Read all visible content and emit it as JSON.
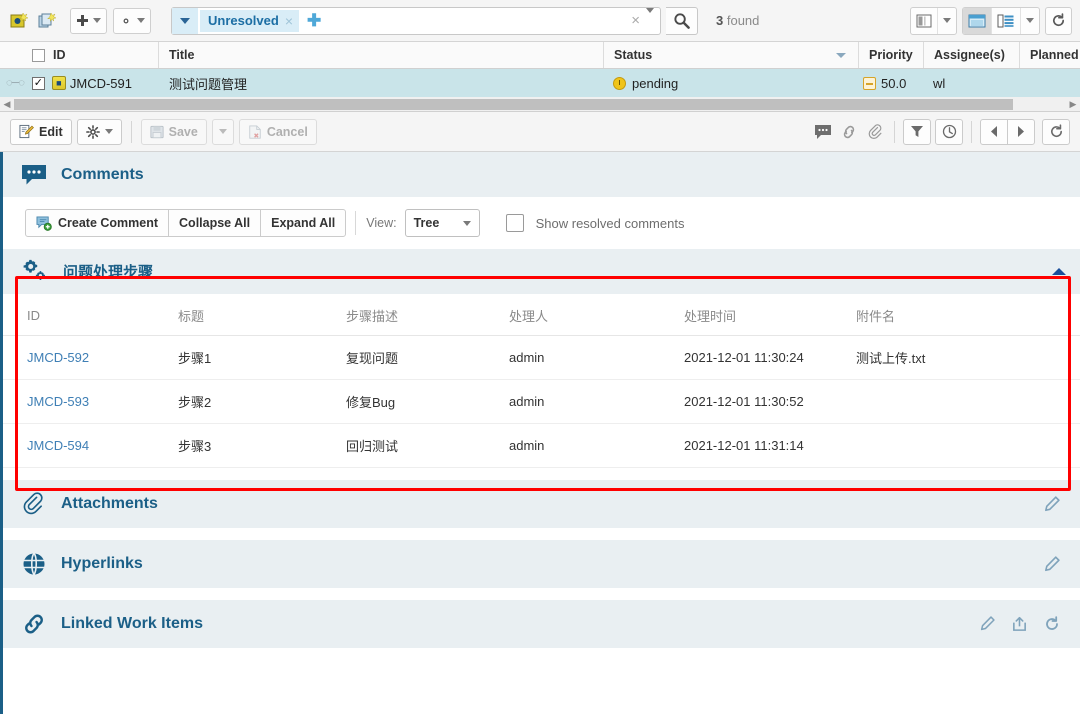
{
  "toolbar": {
    "icons": [
      {
        "name": "new-work-item-icon",
        "glyph": "⬛"
      },
      {
        "name": "new-document-icon",
        "glyph": "⬛"
      }
    ],
    "add_button_label": "",
    "settings_button_label": "",
    "search": {
      "token": "Unresolved",
      "token_remove": "×",
      "add_token": "➕",
      "clear": "×",
      "placeholder": "",
      "results_count": "3",
      "results_label": "found"
    },
    "view_buttons": {
      "columns_label": "",
      "table_view_label": "",
      "detail_view_label": "",
      "refresh_label": "↻"
    }
  },
  "grid": {
    "columns": [
      "ID",
      "Title",
      "Status",
      "Priority",
      "Assignee(s)",
      "Planned"
    ],
    "rows": [
      {
        "id": "JMCD-591",
        "title": "测试问题管理",
        "status": "pending",
        "priority": "50.0",
        "assignee": "wl",
        "planned": "",
        "checked": "✓"
      }
    ]
  },
  "actionbar": {
    "edit_label": "Edit",
    "gear_label": "",
    "save_label": "Save",
    "cancel_label": "Cancel",
    "icons": [
      "comment-icon",
      "link-icon",
      "attachment-icon"
    ],
    "buttons": [
      "filter-icon",
      "history-icon",
      "prev-icon",
      "next-icon",
      "refresh-icon"
    ]
  },
  "comments": {
    "title": "Comments",
    "create_label": "Create Comment",
    "collapse_label": "Collapse All",
    "expand_label": "Expand All",
    "view_label": "View:",
    "view_value": "Tree",
    "show_resolved_label": "Show resolved comments"
  },
  "steps_section": {
    "title": "问题处理步骤",
    "columns": [
      "ID",
      "标题",
      "步骤描述",
      "处理人",
      "处理时间",
      "附件名"
    ],
    "rows": [
      {
        "id": "JMCD-592",
        "title": "步骤1",
        "description": "复现问题",
        "owner": "admin",
        "time": "2021-12-01 11:30:24",
        "attachment": "测试上传.txt"
      },
      {
        "id": "JMCD-593",
        "title": "步骤2",
        "description": "修复Bug",
        "owner": "admin",
        "time": "2021-12-01 11:30:52",
        "attachment": ""
      },
      {
        "id": "JMCD-594",
        "title": "步骤3",
        "description": "回归测试",
        "owner": "admin",
        "time": "2021-12-01 11:31:14",
        "attachment": ""
      }
    ]
  },
  "sections": [
    {
      "title": "Attachments",
      "icon": "paperclip-icon"
    },
    {
      "title": "Hyperlinks",
      "icon": "globe-icon"
    },
    {
      "title": "Linked Work Items",
      "icon": "chain-link-icon"
    }
  ],
  "colors": {
    "accent": "#1b5f87",
    "section_bg": "#e9eff2",
    "row_selected": "#c9e4e9",
    "highlight_border": "#ff0000",
    "link": "#3f7fb5"
  }
}
